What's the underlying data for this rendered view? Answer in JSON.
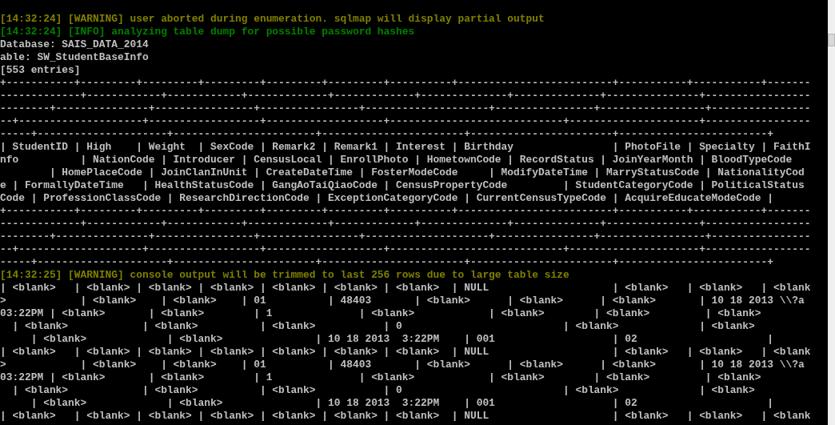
{
  "console": {
    "lines": [
      {
        "kind": "warning",
        "text": "[14:32:24] [WARNING] user aborted during enumeration. sqlmap will display partial output"
      },
      {
        "kind": "info",
        "text": "[14:32:24] [INFO] analyzing table dump for possible password hashes"
      },
      {
        "kind": "plain",
        "text": "Database: SAIS_DATA_2014"
      },
      {
        "kind": "plain",
        "text": "able: SW_StudentBaseInfo"
      },
      {
        "kind": "plain",
        "text": "[553 entries]"
      },
      {
        "kind": "plain",
        "text": "+-----------+---------+---------+---------+---------+---------+----------+-------------------------+-----------+-----------+-------"
      },
      {
        "kind": "plain",
        "text": "-------------+------------+------------+-------------+-------------+--------------+--------------+---------------+-----------------"
      },
      {
        "kind": "plain",
        "text": "--------+---------------+----------------+----------------+--------------------+----------------+-----------------+----------------"
      },
      {
        "kind": "plain",
        "text": "--+--------------------+------------------+-------------------+----------------------------+---------------------+-----------------"
      },
      {
        "kind": "plain",
        "text": "-----+---------------------+-----------------------+-----------------------+-----------------------+------------------------+"
      },
      {
        "kind": "plain",
        "text": "| StudentID | High    | Weight  | SexCode | Remark2 | Remark1 | Interest | Birthday                | PhotoFile | Specialty | FaithI"
      },
      {
        "kind": "plain",
        "text": "nfo          | NationCode | Introducer | CensusLocal | EnrollPhoto | HometownCode | RecordStatus | JoinYearMonth | BloodTypeCode"
      },
      {
        "kind": "plain",
        "text": "        | HomePlaceCode | JoinClanInUnit | CreateDateTime | FosterModeCode     | ModifyDateTime | MarryStatusCode | NationalityCod"
      },
      {
        "kind": "plain",
        "text": "e | FormallyDateTime   | HealthStatusCode | GangAoTaiQiaoCode | CensusPropertyCode         | StudentCategoryCode | PoliticalStatus"
      },
      {
        "kind": "plain",
        "text": "Code | ProfessionClassCode | ResearchDirectionCode | ExceptionCategoryCode | CurrentCensusTypeCode | AcquireEducateModeCode |"
      },
      {
        "kind": "plain",
        "text": "+-----------+---------+---------+---------+---------+---------+----------+-------------------------+-----------+-----------+-------"
      },
      {
        "kind": "plain",
        "text": "-------------+------------+------------+-------------+-------------+--------------+--------------+---------------+-----------------"
      },
      {
        "kind": "plain",
        "text": "--------+---------------+----------------+----------------+--------------------+----------------+-----------------+----------------"
      },
      {
        "kind": "plain",
        "text": "--+--------------------+------------------+-------------------+----------------------------+---------------------+-----------------"
      },
      {
        "kind": "plain",
        "text": "-----+---------------------+-----------------------+-----------------------+-----------------------+------------------------+"
      },
      {
        "kind": "warning",
        "text": "[14:32:25] [WARNING] console output will be trimmed to last 256 rows due to large table size"
      },
      {
        "kind": "plain",
        "text": "| <blank>   | <blank> | <blank> | <blank> | <blank> | <blank> | <blank>  | NULL                    | <blank>   | <blank>   | <blank"
      },
      {
        "kind": "plain",
        "text": ">            | <blank>    | <blank>    | 01          | 48403       | <blank>      | <blank>      | <blank>       | 10 18 2013 \\\\?a"
      },
      {
        "kind": "plain",
        "text": "03:22PM | <blank>       | <blank>        | 1              | <blank>            | <blank>        | <blank>         | <blank>"
      },
      {
        "kind": "plain",
        "text": "  | <blank>            | <blank>          | <blank>           | 0                          | <blank>             | <blank>"
      },
      {
        "kind": "plain",
        "text": "     | <blank>             | <blank>               | 10 18 2013  3:22PM    | 001                   | 02                     |"
      },
      {
        "kind": "plain",
        "text": "| <blank>   | <blank> | <blank> | <blank> | <blank> | <blank> | <blank>  | NULL                    | <blank>   | <blank>   | <blank"
      },
      {
        "kind": "plain",
        "text": ">            | <blank>    | <blank>    | 01          | 48403       | <blank>      | <blank>      | <blank>       | 10 18 2013 \\\\?a"
      },
      {
        "kind": "plain",
        "text": "03:22PM | <blank>       | <blank>        | 1              | <blank>            | <blank>        | <blank>         | <blank>"
      },
      {
        "kind": "plain",
        "text": "  | <blank>            | <blank>          | <blank>           | 0                          | <blank>             | <blank>"
      },
      {
        "kind": "plain",
        "text": "     | <blank>             | <blank>               | 10 18 2013  3:22PM    | 001                   | 02                     |"
      },
      {
        "kind": "plain",
        "text": "| <blank>   | <blank> | <blank> | <blank> | <blank> | <blank> | <blank>  | NULL                    | <blank>   | <blank>   | <blank"
      }
    ]
  }
}
